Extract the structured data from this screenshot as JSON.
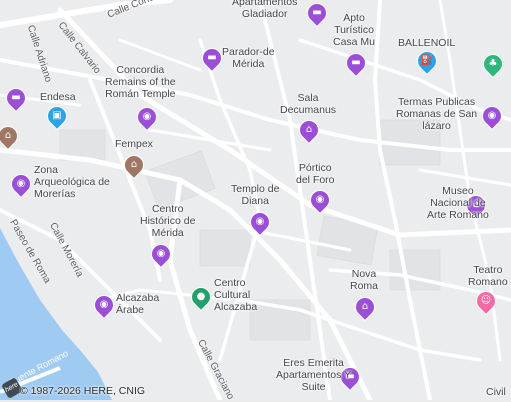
{
  "streets": {
    "concordia": "Calle Concordia",
    "adriano": "Calle Adriano",
    "calvario": "Calle Calvario",
    "paseo_roma": "Paseo de Roma",
    "moreria": "Calle Morería",
    "graciano": "Calle Graciano",
    "puente_romano": "Puente Romano"
  },
  "places": {
    "apartamentos_gladiador": "Apartamentos\nGladiador",
    "apto_turistico": "Apto\nTurístico\nCasa Mu",
    "balle_noil": "BALLENOIL",
    "parador": "Parador-de\nMérida",
    "concordia_remains": "Concordia\nRemains of the\nRomán Temple",
    "endesa": "Endesa",
    "fempex": "Fempex",
    "sala_decumanus": "Sala\nDecumanus",
    "termas": "Termas Publicas\nRomanas de San\nlázaro",
    "zona_arqueologica": "Zona\nArqueológica de\nMorerías",
    "portico_foro": "Pórtico\ndel Foro",
    "templo_diana": "Templo de\nDiana",
    "museo_nacional": "Museo\nNacional de\nArte Romano",
    "centro_historico": "Centro\nHistórico de\nMérida",
    "nova_roma": "Nova\nRoma",
    "teatro_romano": "Teatro\nRomano",
    "alcazaba_arabe": "Alcazaba\nÁrabe",
    "centro_cultural": "Centro\nCultural\nAlcazaba",
    "eres_emerita": "Eres Emerita\nApartamentos Y\nSuite",
    "civil": "Civil"
  },
  "icons": {
    "hotel": "bed-icon",
    "photo": "camera-icon",
    "museum": "museum-icon",
    "fuel": "fuel-icon",
    "shop": "shopping-icon",
    "park": "park-icon",
    "theater": "theater-icon",
    "culture": "culture-center-icon"
  },
  "colors": {
    "poi_purple": "#9b4fd6",
    "museum_brown": "#a07766",
    "fuel_blue": "#2fa1e6",
    "park_green": "#2fb77c",
    "theater_pink": "#f26ba6",
    "culture_green": "#25a06b",
    "water": "#99c9f5"
  },
  "copyright": "© 1987-2026 HERE, CNIG",
  "logo": "here"
}
